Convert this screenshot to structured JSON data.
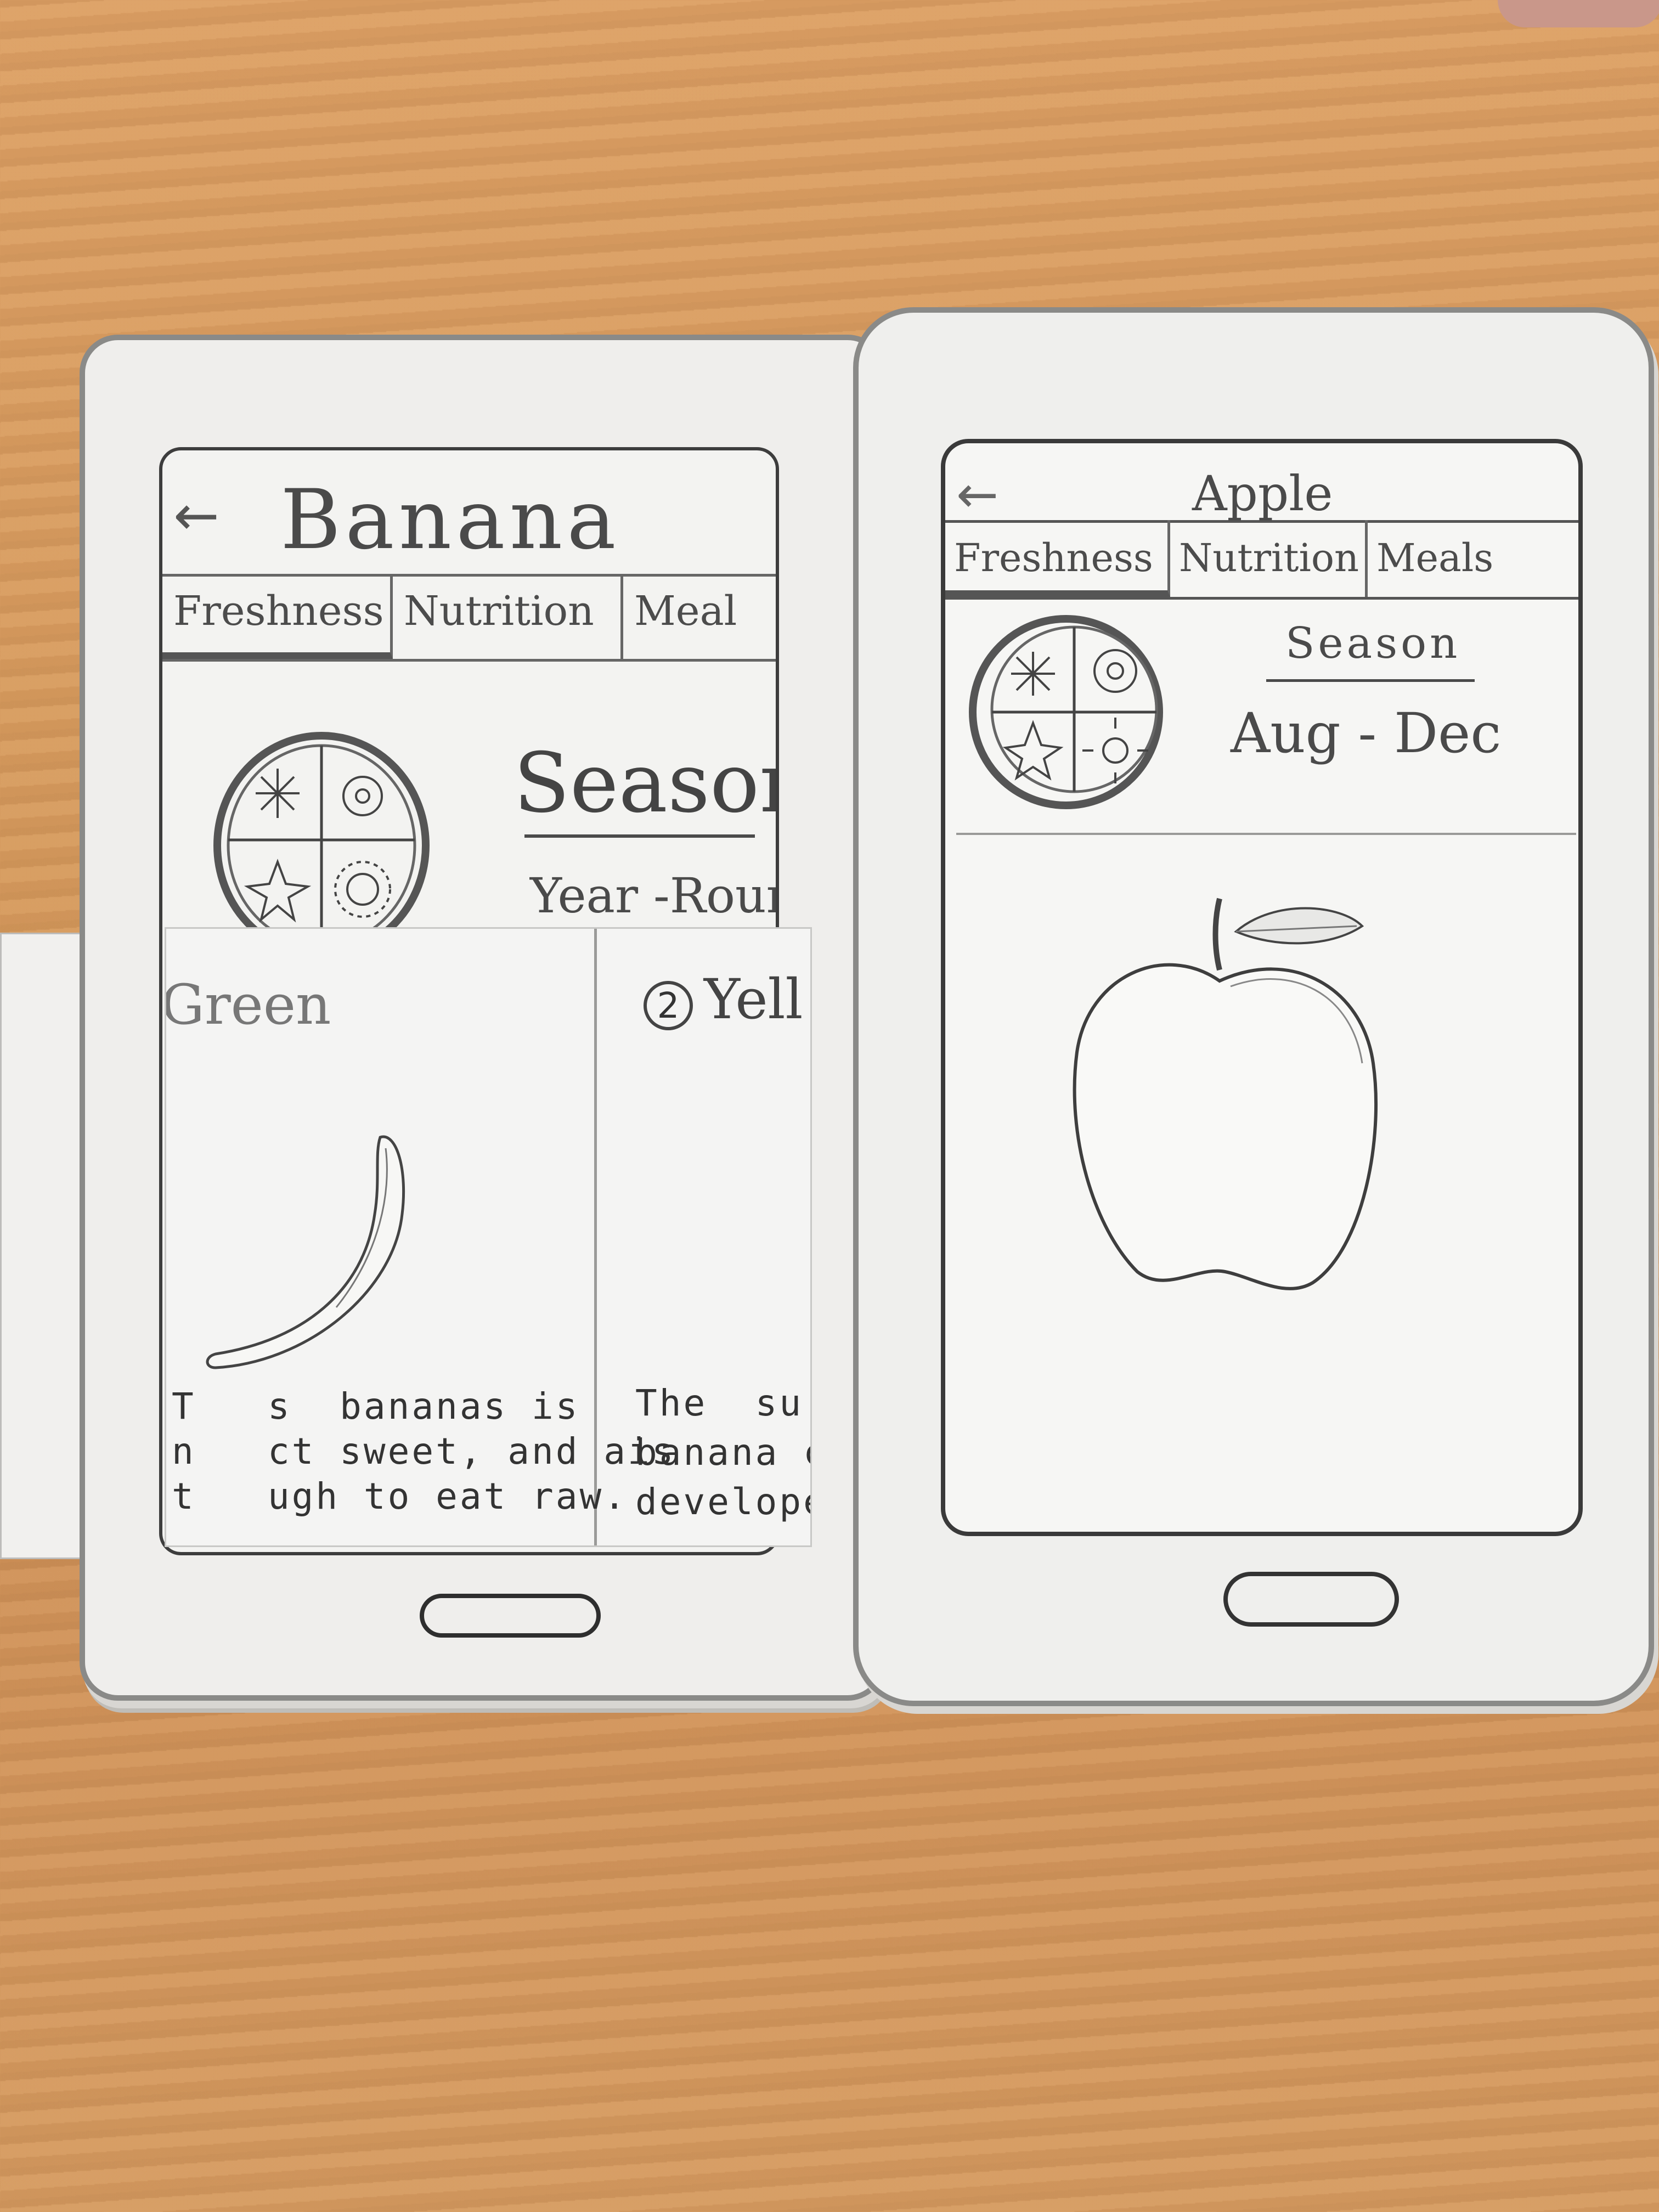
{
  "banana_screen": {
    "back_glyph": "←",
    "title": "Banana",
    "tabs": [
      "Freshness",
      "Nutrition",
      "Meal"
    ],
    "season_label": "Season",
    "season_value": "Year -Round",
    "cards": [
      {
        "title": "Green",
        "description": "T   s  bananas is\nn   ct sweet, and ais\nt   ugh to eat raw."
      },
      {
        "number": "2",
        "title": "Yell",
        "description": "The  su\nbanana c\ndeveloped"
      }
    ]
  },
  "apple_screen": {
    "back_glyph": "←",
    "title": "Apple",
    "tabs": [
      "Freshness",
      "Nutrition",
      "Meals"
    ],
    "season_label": "Season",
    "season_value": "Aug - Dec"
  },
  "colors": {
    "table": "#d59a5e",
    "paper": "#f3f3f1",
    "pencil": "#4a4a4a"
  },
  "icons": [
    "season-wheel-icon",
    "banana-illustration",
    "apple-illustration",
    "back-arrow-icon",
    "home-button"
  ]
}
